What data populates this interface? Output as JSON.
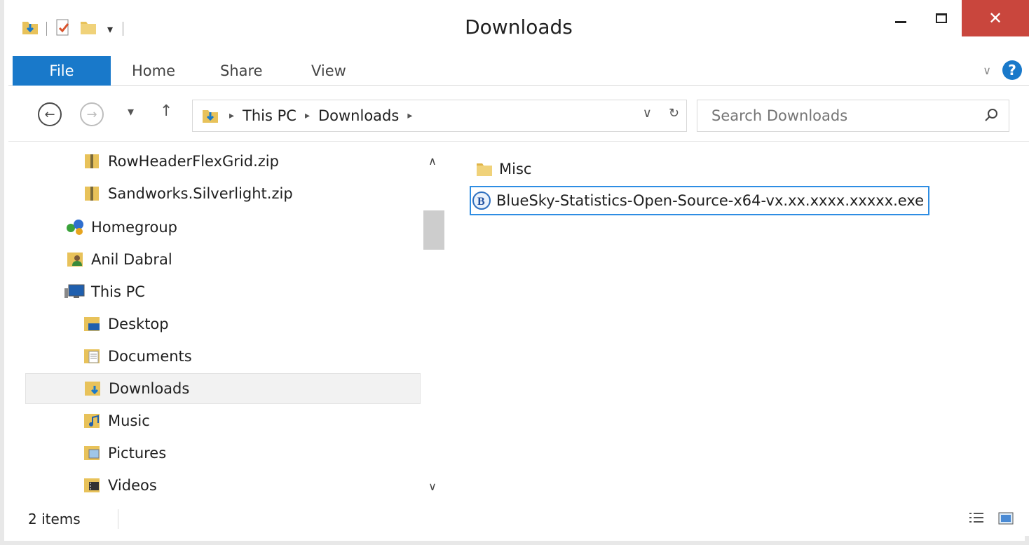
{
  "window": {
    "title": "Downloads",
    "close_glyph": "✕"
  },
  "ribbon": {
    "tabs": [
      {
        "label": "File",
        "active": true
      },
      {
        "label": "Home"
      },
      {
        "label": "Share"
      },
      {
        "label": "View"
      }
    ],
    "help_glyph": "?"
  },
  "navbar": {
    "breadcrumbs": [
      "This PC",
      "Downloads"
    ],
    "search_placeholder": "Search Downloads"
  },
  "navpane": {
    "items": [
      {
        "label": "RowHeaderFlexGrid.zip",
        "icon": "zip-folder-icon",
        "indent": 2
      },
      {
        "label": "Sandworks.Silverlight.zip",
        "icon": "zip-folder-icon",
        "indent": 2
      },
      {
        "label": "Homegroup",
        "icon": "homegroup-icon",
        "indent": 1
      },
      {
        "label": "Anil Dabral",
        "icon": "user-folder-icon",
        "indent": 1
      },
      {
        "label": "This PC",
        "icon": "computer-icon",
        "indent": 1
      },
      {
        "label": "Desktop",
        "icon": "desktop-folder-icon",
        "indent": 2
      },
      {
        "label": "Documents",
        "icon": "documents-folder-icon",
        "indent": 2
      },
      {
        "label": "Downloads",
        "icon": "downloads-folder-icon",
        "indent": 2,
        "selected": true
      },
      {
        "label": "Music",
        "icon": "music-folder-icon",
        "indent": 2
      },
      {
        "label": "Pictures",
        "icon": "pictures-folder-icon",
        "indent": 2
      },
      {
        "label": "Videos",
        "icon": "videos-folder-icon",
        "indent": 2
      }
    ]
  },
  "content": {
    "files": [
      {
        "name": "Misc",
        "icon": "folder-icon"
      },
      {
        "name": "BlueSky-Statistics-Open-Source-x64-vx.xx.xxxx.xxxxx.exe",
        "icon": "bluesky-app-icon",
        "focused": true
      }
    ]
  },
  "status": {
    "item_count": "2 items"
  },
  "colors": {
    "accent": "#1979ca",
    "close": "#c9463d",
    "selection_border": "#2e8de3",
    "folder": "#e8c25a"
  }
}
